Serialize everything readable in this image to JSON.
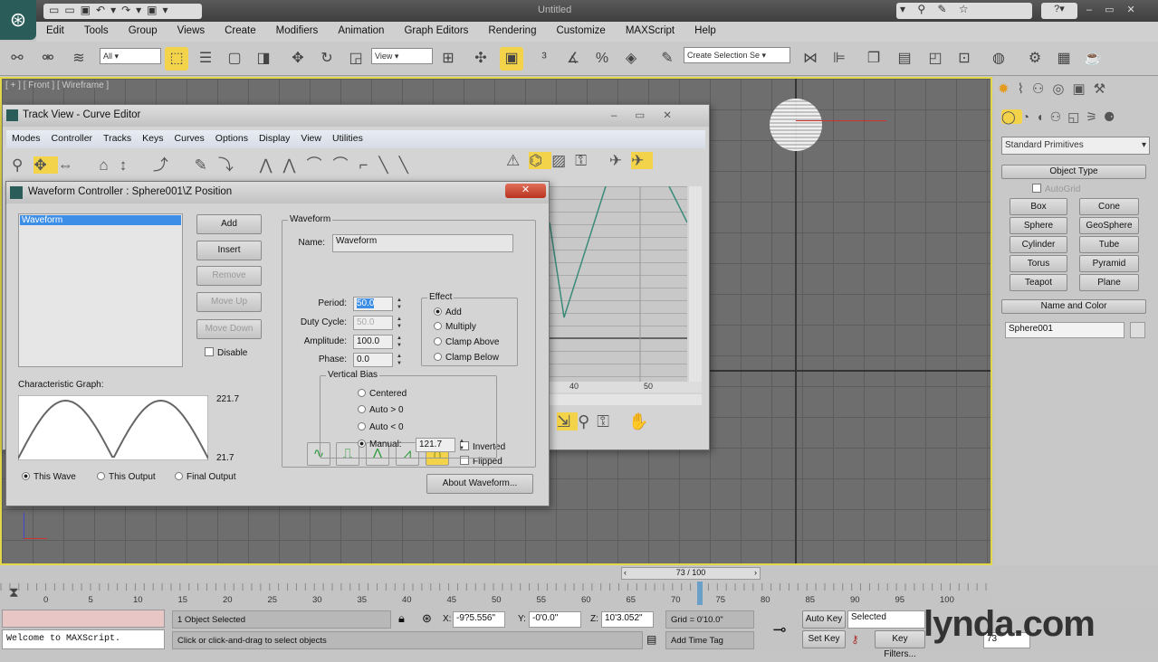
{
  "app": {
    "title": "Untitled",
    "menus": [
      "Edit",
      "Tools",
      "Group",
      "Views",
      "Create",
      "Modifiers",
      "Animation",
      "Graph Editors",
      "Rendering",
      "Customize",
      "MAXScript",
      "Help"
    ]
  },
  "toolbar": {
    "filter": "All",
    "ref_coord": "View",
    "selection_set": "Create Selection Se"
  },
  "viewport": {
    "label": "[ + ] [ Front ] [ Wireframe ]"
  },
  "command_panel": {
    "category": "Standard Primitives",
    "object_type_title": "Object Type",
    "autogrid": "AutoGrid",
    "primitives": [
      "Box",
      "Cone",
      "Sphere",
      "GeoSphere",
      "Cylinder",
      "Tube",
      "Torus",
      "Pyramid",
      "Teapot",
      "Plane"
    ],
    "name_color_title": "Name and Color",
    "object_name": "Sphere001"
  },
  "curve_editor": {
    "title": "Track View - Curve Editor",
    "menus": [
      "Modes",
      "Controller",
      "Tracks",
      "Keys",
      "Curves",
      "Options",
      "Display",
      "View",
      "Utilities"
    ],
    "ruler": [
      "40",
      "50"
    ]
  },
  "waveform_dialog": {
    "title": "Waveform Controller : Sphere001\\Z Position",
    "list": [
      "Waveform"
    ],
    "buttons": {
      "add": "Add",
      "insert": "Insert",
      "remove": "Remove",
      "move_up": "Move Up",
      "move_down": "Move Down",
      "about": "About Waveform..."
    },
    "disable": "Disable",
    "group_title": "Waveform",
    "name_label": "Name:",
    "name_value": "Waveform",
    "inverted": "Inverted",
    "flipped": "Flipped",
    "period_label": "Period:",
    "period": "50.0",
    "duty_label": "Duty Cycle:",
    "duty": "50.0",
    "amplitude_label": "Amplitude:",
    "amplitude": "100.0",
    "phase_label": "Phase:",
    "phase": "0.0",
    "effect_title": "Effect",
    "effects": [
      "Add",
      "Multiply",
      "Clamp Above",
      "Clamp Below"
    ],
    "effect_selected": 0,
    "bias_title": "Vertical Bias",
    "bias": [
      "Centered",
      "Auto > 0",
      "Auto < 0",
      "Manual:"
    ],
    "bias_selected": 3,
    "manual_value": "121.7",
    "graph_title": "Characteristic Graph:",
    "graph_max": "221.7",
    "graph_min": "21.7",
    "graph_modes": [
      "This Wave",
      "This Output",
      "Final Output"
    ],
    "graph_mode_selected": 0
  },
  "timeline": {
    "slider": "73 / 100",
    "current_frame": 73,
    "ticks": [
      "0",
      "5",
      "10",
      "15",
      "20",
      "25",
      "30",
      "35",
      "40",
      "45",
      "50",
      "55",
      "60",
      "65",
      "70",
      "75",
      "80",
      "85",
      "90",
      "95",
      "100"
    ]
  },
  "status": {
    "maxscript": "Welcome to MAXScript.",
    "selected": "1 Object Selected",
    "prompt": "Click or click-and-drag to select objects",
    "x_label": "X:",
    "x": "-9?5.556\"",
    "y_label": "Y:",
    "y": "-0'0.0\"",
    "z_label": "Z:",
    "z": "10'3.052\"",
    "grid": "Grid = 0'10.0\"",
    "add_time_tag": "Add Time Tag",
    "auto_key": "Auto Key",
    "set_key": "Set Key",
    "key_mode": "Selected",
    "key_filters": "Key Filters...",
    "frame": "73"
  },
  "watermark": "lynda.com"
}
